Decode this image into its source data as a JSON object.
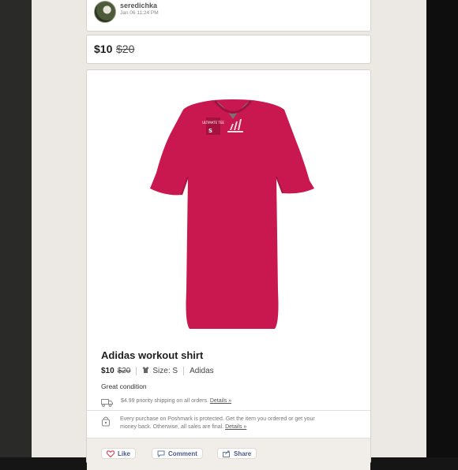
{
  "post": {
    "username": "seredichka",
    "timestamp": "Jan 06 11:24 PM"
  },
  "pricing": {
    "current": "$10",
    "original": "$20"
  },
  "listing": {
    "title": "Adidas workout shirt",
    "price_current": "$10",
    "price_original": "$20",
    "size": "Size: S",
    "brand": "Adidas",
    "condition": "Great condition",
    "shipping_text": "$4.99 priority shipping on all orders.",
    "shipping_link": "Details »",
    "protection_text": "Every purchase on Poshmark is protected. Get the item you ordered or get your money back. Otherwise, all sales are final.",
    "protection_link": "Details »",
    "image_label": "ULTIMATE TEE"
  },
  "actions": {
    "like": "Like",
    "comment": "Comment",
    "share": "Share"
  },
  "icons": [
    "avatar",
    "hanger-icon",
    "shipping-truck-icon",
    "shield-lock-icon",
    "heart-icon",
    "comment-bubble-icon",
    "share-icon"
  ],
  "colors": {
    "shirt": "#c8184f",
    "action_text": "#4a5c8a",
    "heart": "#e0455f"
  }
}
